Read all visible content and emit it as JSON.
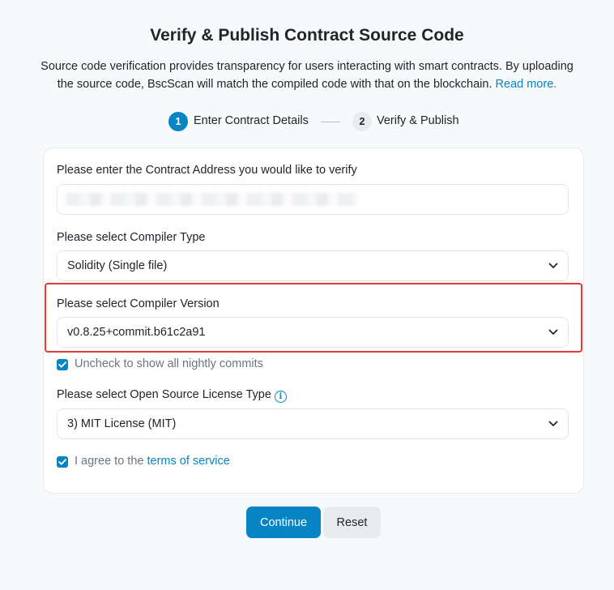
{
  "page": {
    "title": "Verify & Publish Contract Source Code",
    "description": "Source code verification provides transparency for users interacting with smart contracts. By uploading the source code, BscScan will match the compiled code with that on the blockchain.",
    "read_more": "Read more."
  },
  "steps": [
    {
      "number": "1",
      "label": "Enter Contract Details",
      "state": "active"
    },
    {
      "number": "2",
      "label": "Verify & Publish",
      "state": "inactive"
    }
  ],
  "form": {
    "address_label": "Please enter the Contract Address you would like to verify",
    "compiler_type_label": "Please select Compiler Type",
    "compiler_type_value": "Solidity (Single file)",
    "compiler_version_label": "Please select Compiler Version",
    "compiler_version_value": "v0.8.25+commit.b61c2a91",
    "nightly_label": "Uncheck to show all nightly commits",
    "license_label": "Please select Open Source License Type",
    "license_value": "3) MIT License (MIT)",
    "agree_prefix": "I agree to the",
    "terms_link": "terms of service"
  },
  "buttons": {
    "continue": "Continue",
    "reset": "Reset"
  },
  "colors": {
    "accent": "#0784c3",
    "highlight": "#e53935"
  }
}
